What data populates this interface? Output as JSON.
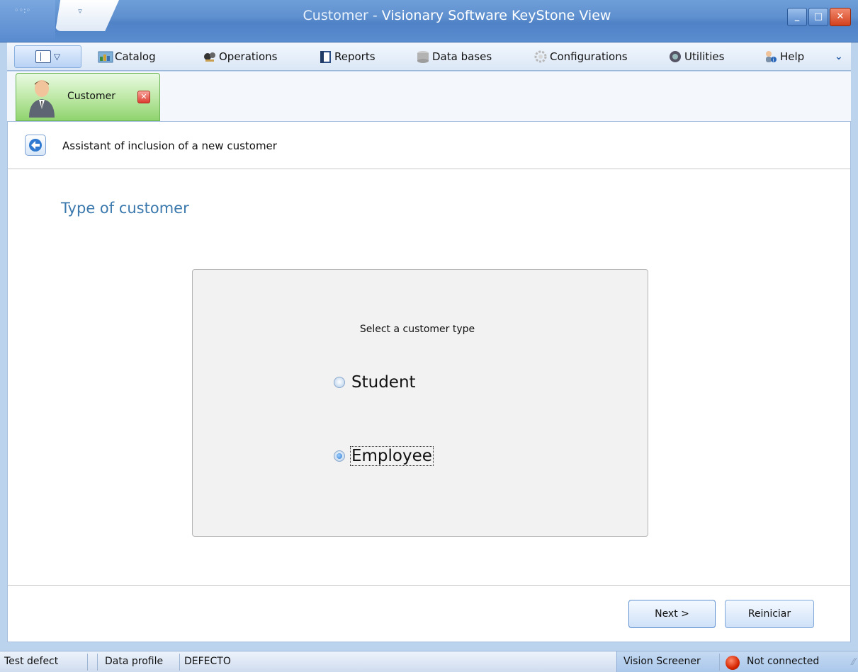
{
  "window": {
    "title_doc": "Customer",
    "title_sep": " - ",
    "title_app": "Visionary Software KeyStone View",
    "minimize": "_",
    "maximize": "□",
    "close": "✕"
  },
  "menubar": {
    "items": [
      {
        "label": "Catalog",
        "icon": "catalog-icon"
      },
      {
        "label": "Operations",
        "icon": "operations-icon"
      },
      {
        "label": "Reports",
        "icon": "reports-icon"
      },
      {
        "label": "Data bases",
        "icon": "database-icon"
      },
      {
        "label": "Configurations",
        "icon": "configurations-icon"
      },
      {
        "label": "Utilities",
        "icon": "utilities-icon"
      },
      {
        "label": "Help",
        "icon": "help-icon"
      }
    ],
    "overflow": "⌄"
  },
  "tabs": {
    "active": {
      "label": "Customer",
      "close": "✕"
    }
  },
  "content": {
    "header_text": "Assistant of inclusion of a new customer",
    "section_title": "Type of customer",
    "prompt": "Select a customer type",
    "options": [
      {
        "label": "Student",
        "checked": false
      },
      {
        "label": "Employee",
        "checked": true
      }
    ],
    "next_button": "Next >",
    "reset_button": "Reiniciar"
  },
  "statusbar": {
    "left_item": "Test defect",
    "profile_label": "Data profile",
    "profile_value": "DEFECTO",
    "screener": "Vision Screener",
    "connection": "Not connected"
  },
  "colors": {
    "accent_title": "#3a78ad",
    "tab_green": "#8fd36e",
    "status_red": "#d62500"
  }
}
